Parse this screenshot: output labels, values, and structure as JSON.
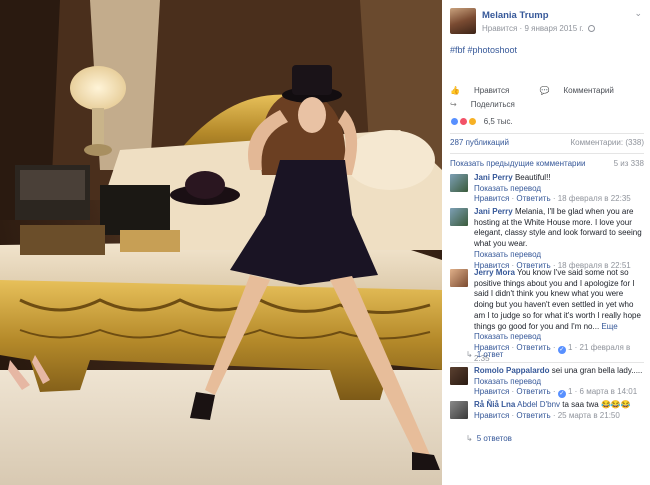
{
  "post": {
    "author": "Melania Trump",
    "like_link": "Нравится",
    "date": "9 января 2015 г.",
    "hashtags": "#fbf #photoshoot",
    "like_action": "Нравится",
    "comment_action": "Комментарий",
    "share_action": "Поделиться",
    "reactions_count": "6,5 тыс.",
    "shares": "287 публикаций",
    "comments_count": "Комментарии: (338)",
    "show_previous": "Показать предыдущие комментарии",
    "pagination": "5 из 338"
  },
  "comments": [
    {
      "name": "Jani Perry",
      "text": "Beautiful!!",
      "translate": "Показать перевод",
      "like": "Нравится",
      "reply": "Ответить",
      "date": "18 февраля в 22:35",
      "likes": "",
      "replies": ""
    },
    {
      "name": "Jani Perry",
      "text": "Melania, I'll be glad when you are hosting at the White House more. I love your elegant, classy style and look forward to seeing what you wear.",
      "translate": "Показать перевод",
      "like": "Нравится",
      "reply": "Ответить",
      "date": "18 февраля в 22:51",
      "likes": "",
      "replies": ""
    },
    {
      "name": "Jerry Mora",
      "text": "You know I've said some not so positive things about you and I apologize for I said I didn't think you knew what you were doing but you haven't even settled in yet who am I to judge so for what it's worth I really hope things go good for you and I'm no...",
      "more": "Еще",
      "translate": "Показать перевод",
      "like": "Нравится",
      "reply": "Ответить",
      "date": "21 февраля в 2:35",
      "likes": "1",
      "replies": "1 ответ"
    },
    {
      "name": "Romolo Pappalardo",
      "text": "sei una gran bella lady.....",
      "translate": "Показать перевод",
      "like": "Нравится",
      "reply": "Ответить",
      "date": "6 марта в 14:01",
      "likes": "1",
      "replies": ""
    },
    {
      "name": "Rå Ñiå Lna",
      "name_extra": "Abdel D'bnv",
      "text": "ta saa twa 😂😂😂",
      "translate": "",
      "like": "Нравится",
      "reply": "Ответить",
      "date": "25 марта в 21:50",
      "likes": "",
      "replies": "5 ответов"
    }
  ],
  "colors": {
    "link": "#365899",
    "meta": "#90949c",
    "text": "#1d2129",
    "like_blue": "#5890ff",
    "love_red": "#f25268",
    "wow_yellow": "#f7b125"
  }
}
